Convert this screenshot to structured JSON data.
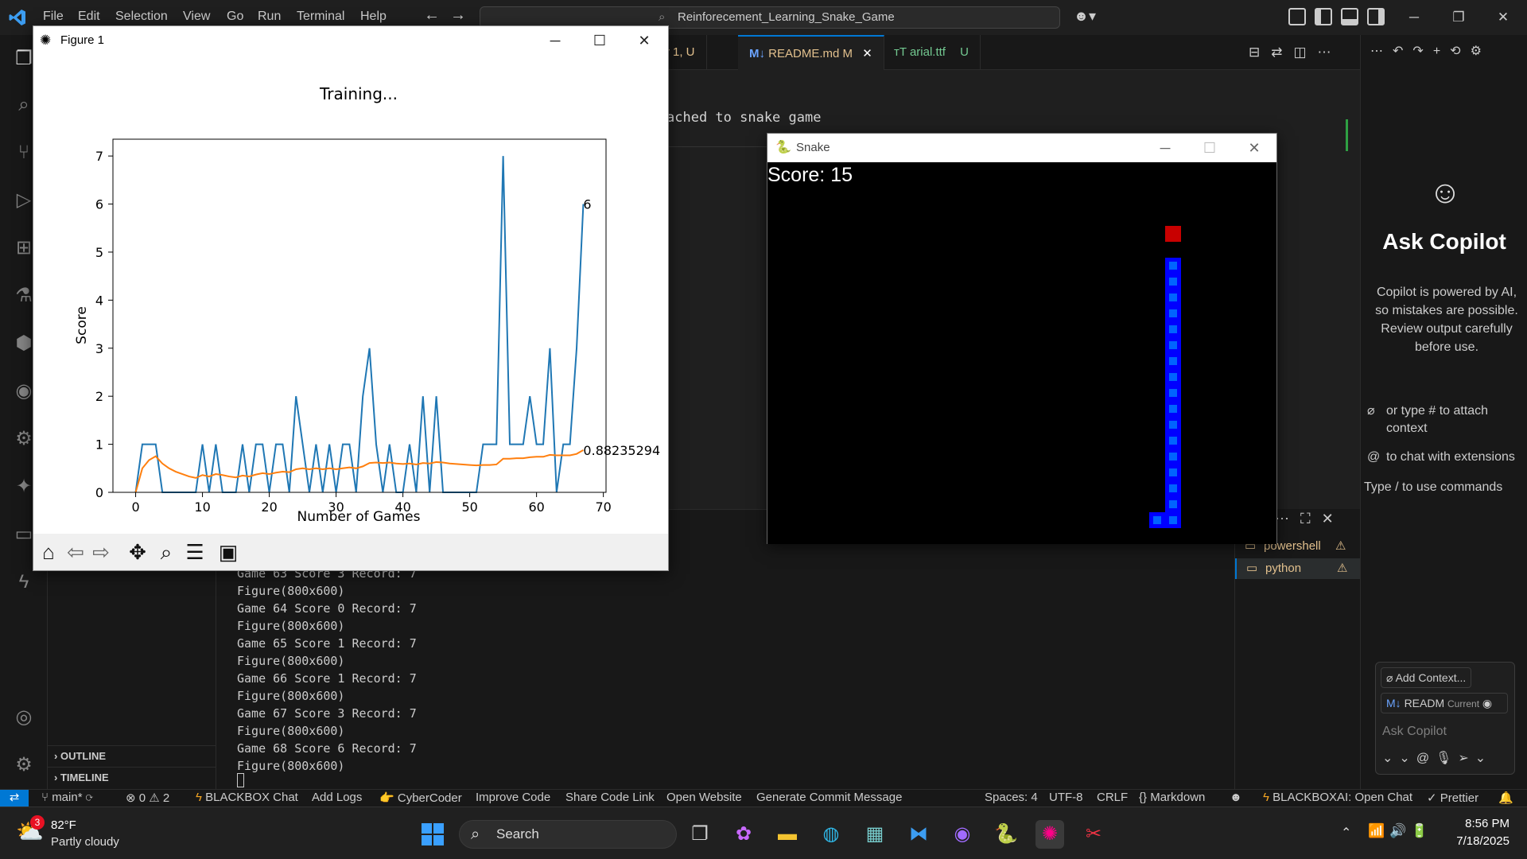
{
  "menu": [
    "File",
    "Edit",
    "Selection",
    "View",
    "Go",
    "Run",
    "Terminal",
    "Help"
  ],
  "search": {
    "text": "Reinforecement_Learning_Snake_Game"
  },
  "tabs": [
    {
      "label": "py 1, U"
    },
    {
      "label": "README.md",
      "badge": "M"
    },
    {
      "label": "arial.ttf",
      "badge": "U"
    }
  ],
  "editor": {
    "visible_text": "ached to snake game"
  },
  "sidebar": {
    "outline": "OUTLINE",
    "timeline": "TIMELINE"
  },
  "terminal": {
    "lines": [
      "Game 63 Score 3 Record: 7",
      "Figure(800x600)",
      "Game 64 Score 0 Record: 7",
      "Figure(800x600)",
      "Game 65 Score 1 Record: 7",
      "Figure(800x600)",
      "Game 66 Score 1 Record: 7",
      "Figure(800x600)",
      "Game 67 Score 3 Record: 7",
      "Figure(800x600)",
      "Game 68 Score 6 Record: 7",
      "Figure(800x600)"
    ],
    "shells": [
      "powershell",
      "python"
    ]
  },
  "copilot": {
    "title": "Ask Copilot",
    "disclaimer": "Copilot is powered by AI, so mistakes are possible. Review output carefully before use.",
    "hint1": "or type # to attach context",
    "hint2": "to chat with extensions",
    "hint3": "Type / to use commands",
    "add_context": "Add Context...",
    "file_chip": "READM",
    "file_chip_tag": "Current",
    "input_placeholder": "Ask Copilot"
  },
  "statusbar": {
    "branch": "main*",
    "errors": "0",
    "warnings": "2",
    "items_left": [
      "BLACKBOX Chat",
      "Add Logs",
      "CyberCoder",
      "Improve Code",
      "Share Code Link",
      "Open Website",
      "Generate Commit Message"
    ],
    "spaces": "Spaces: 4",
    "encoding": "UTF-8",
    "eol": "CRLF",
    "language": "Markdown",
    "blackbox": "BLACKBOXAI: Open Chat",
    "prettier": "Prettier"
  },
  "taskbar": {
    "weather_temp": "82°F",
    "weather_desc": "Partly cloudy",
    "weather_badge": "3",
    "search": "Search",
    "time": "8:56 PM",
    "date": "7/18/2025"
  },
  "figure_window": {
    "title": "Figure 1"
  },
  "snake_window": {
    "title": "Snake",
    "score_text": "Score: 15"
  },
  "chart_data": {
    "type": "line",
    "title": "Training...",
    "xlabel": "Number of Games",
    "ylabel": "Score",
    "xlim": [
      -3.4,
      70.4
    ],
    "ylim": [
      0,
      7.35
    ],
    "xticks": [
      0,
      10,
      20,
      30,
      40,
      50,
      60,
      70
    ],
    "yticks": [
      0,
      1,
      2,
      3,
      4,
      5,
      6,
      7
    ],
    "series": [
      {
        "color": "#1f77b4",
        "values": [
          0,
          1,
          1,
          1,
          0,
          0,
          0,
          0,
          0,
          0,
          1,
          0,
          1,
          0,
          0,
          0,
          1,
          0,
          1,
          1,
          0,
          1,
          1,
          0,
          2,
          1,
          0,
          1,
          0,
          1,
          0,
          1,
          1,
          0,
          2,
          3,
          1,
          0,
          1,
          0,
          0,
          1,
          0,
          2,
          0,
          2,
          0,
          0,
          0,
          0,
          0,
          0,
          1,
          1,
          1,
          7,
          1,
          1,
          1,
          2,
          1,
          1,
          3,
          0,
          1,
          1,
          3,
          6
        ]
      },
      {
        "color": "#ff7f0e",
        "values": [
          0,
          0.5,
          0.67,
          0.75,
          0.6,
          0.5,
          0.43,
          0.38,
          0.33,
          0.3,
          0.36,
          0.33,
          0.38,
          0.36,
          0.33,
          0.31,
          0.35,
          0.33,
          0.37,
          0.4,
          0.38,
          0.41,
          0.43,
          0.42,
          0.48,
          0.5,
          0.48,
          0.5,
          0.48,
          0.5,
          0.48,
          0.5,
          0.52,
          0.5,
          0.54,
          0.61,
          0.62,
          0.61,
          0.62,
          0.6,
          0.59,
          0.6,
          0.58,
          0.61,
          0.6,
          0.63,
          0.62,
          0.6,
          0.59,
          0.58,
          0.57,
          0.56,
          0.57,
          0.57,
          0.58,
          0.7,
          0.7,
          0.71,
          0.71,
          0.73,
          0.74,
          0.74,
          0.78,
          0.77,
          0.77,
          0.77,
          0.8,
          0.88
        ]
      }
    ],
    "annotations": [
      {
        "x": 67,
        "y": 6,
        "text": "6"
      },
      {
        "x": 67,
        "y": 0.88,
        "text": "0.88235294"
      }
    ]
  },
  "colors": {
    "accent": "#0078d4",
    "snake_body": "#0000ff",
    "snake_inner": "#0064ff",
    "food": "#c80000"
  }
}
